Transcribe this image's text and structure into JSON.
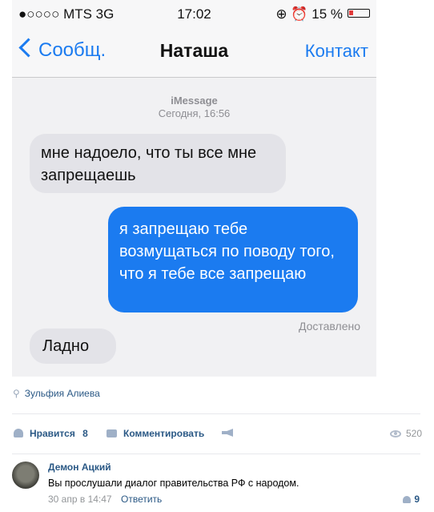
{
  "phone": {
    "status": {
      "carrier": "●○○○○ MTS  3G",
      "time": "17:02",
      "right": "⊕ ⏰ 15 %"
    },
    "nav": {
      "back": "Сообщ.",
      "title": "Наташа",
      "contact": "Контакт"
    },
    "thread": {
      "service": "iMessage",
      "timestamp": "Сегодня, 16:56",
      "messages": [
        {
          "from": "them",
          "text": "мне надоело, что ты все мне запрещаешь"
        },
        {
          "from": "me",
          "text": "я запрещаю тебе возмущаться по поводу того, что я тебе все запрещаю"
        },
        {
          "from": "them",
          "text": "Ладно"
        }
      ],
      "delivered": "Доставлено"
    }
  },
  "post": {
    "author": "Зульфия Алиева",
    "like_label": "Нравится",
    "like_count": "8",
    "comment_label": "Комментировать",
    "views": "520"
  },
  "comment": {
    "name": "Демон Ацкий",
    "text": "Вы прослушали диалог правительства РФ с народом.",
    "date": "30 апр в 14:47",
    "reply": "Ответить",
    "likes": "9"
  }
}
